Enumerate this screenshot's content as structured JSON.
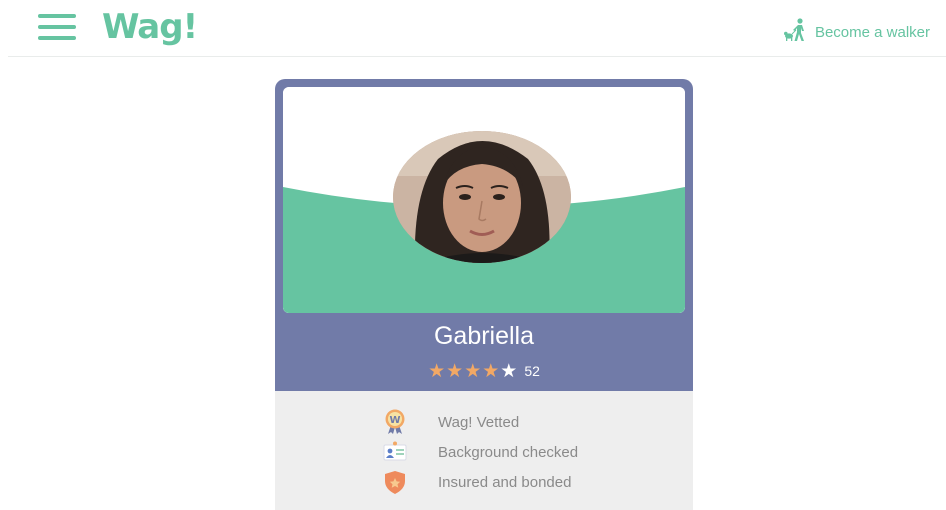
{
  "header": {
    "logo": "Wag!",
    "walker_link": "Become a walker",
    "menu_icon": "hamburger-menu-icon",
    "walker_icon": "walker-with-dog-icon"
  },
  "profile": {
    "name": "Gabriella",
    "rating": {
      "stars_filled": 4,
      "stars_total": 5,
      "review_count": "52"
    }
  },
  "badges": [
    {
      "label": "Wag! Vetted",
      "icon": "vetted-ribbon-icon"
    },
    {
      "label": "Background checked",
      "icon": "id-card-icon"
    },
    {
      "label": "Insured and bonded",
      "icon": "shield-star-icon"
    }
  ],
  "colors": {
    "brand_green": "#66c4a1",
    "card_purple": "#717ba8",
    "star_orange": "#f2a865",
    "badge_bg": "#eeeeee",
    "badge_text": "#8a8a8a"
  }
}
